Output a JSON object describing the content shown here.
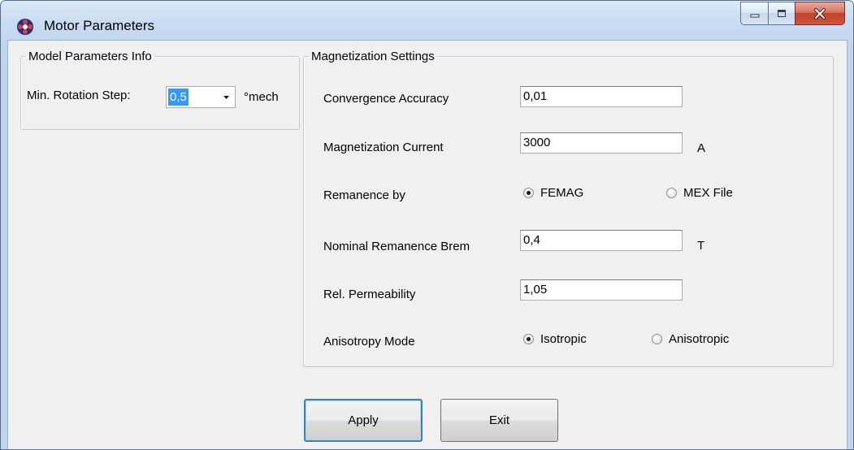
{
  "window": {
    "title": "Motor Parameters",
    "controls": {
      "minimize_icon": "minimize-icon",
      "maximize_icon": "maximize-icon",
      "close_icon": "close-icon"
    }
  },
  "model_group": {
    "legend": "Model Parameters Info",
    "rotation_step_label": "Min. Rotation Step:",
    "rotation_step_value": "0,5",
    "rotation_step_unit": "°mech"
  },
  "magnetization_group": {
    "legend": "Magnetization Settings",
    "convergence": {
      "label": "Convergence Accuracy",
      "value": "0,01"
    },
    "current": {
      "label": "Magnetization Current",
      "value": "3000",
      "unit": "A"
    },
    "remanence_by": {
      "label": "Remanence by",
      "options": [
        "FEMAG",
        "MEX File"
      ],
      "selected": "FEMAG"
    },
    "nominal_remanence": {
      "label": "Nominal Remanence Brem",
      "value": "0,4",
      "unit": "T"
    },
    "permeability": {
      "label": "Rel. Permeability",
      "value": "1,05"
    },
    "anisotropy": {
      "label": "Anisotropy Mode",
      "options": [
        "Isotropic",
        "Anisotropic"
      ],
      "selected": "Isotropic"
    }
  },
  "buttons": {
    "apply": "Apply",
    "exit": "Exit"
  },
  "colors": {
    "title_bar": "#c7dbf2",
    "selection": "#3399ff",
    "close_button": "#c2402a",
    "client_bg": "#f0f0f0"
  }
}
